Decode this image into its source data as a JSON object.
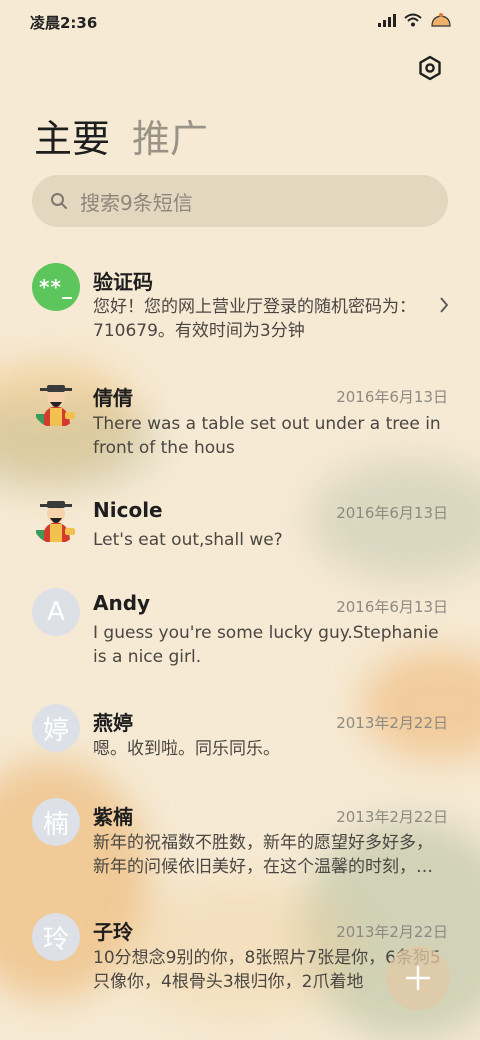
{
  "status": {
    "time": "凌晨2:36"
  },
  "tabs": {
    "primary": "主要",
    "promotions": "推广"
  },
  "search": {
    "placeholder": "搜索9条短信"
  },
  "messages": [
    {
      "avatar_text": "**_",
      "sender": "验证码",
      "date": "",
      "preview": "您好！您的网上营业厅登录的随机密码为：710679。有效时间为3分钟"
    },
    {
      "avatar_text": "",
      "sender": "倩倩",
      "date": "2016年6月13日",
      "preview": "There was a table set out under a tree in front of the hous"
    },
    {
      "avatar_text": "",
      "sender": "Nicole",
      "date": "2016年6月13日",
      "preview": "Let's eat out,shall we?"
    },
    {
      "avatar_text": "A",
      "sender": "Andy",
      "date": "2016年6月13日",
      "preview": "I guess you're some lucky guy.Stephanie is a nice girl."
    },
    {
      "avatar_text": "婷",
      "sender": "燕婷",
      "date": "2013年2月22日",
      "preview": "嗯。收到啦。同乐同乐。"
    },
    {
      "avatar_text": "楠",
      "sender": "紫楠",
      "date": "2013年2月22日",
      "preview": "新年的祝福数不胜数，新年的愿望好多好多，新年的问候依旧美好，在这个温馨的时刻，…"
    },
    {
      "avatar_text": "玲",
      "sender": "子玲",
      "date": "2013年2月22日",
      "preview": "10分想念9别的你，8张照片7张是你，6条狗5只像你，4根骨头3根归你，2爪着地"
    }
  ],
  "colors": {
    "background": "#f6ead4",
    "verification_avatar": "#5cc55c",
    "letter_avatar": "#dde0e6"
  },
  "icons": {
    "settings": "settings-hex-icon",
    "search": "search-icon",
    "compose": "plus-icon",
    "more": "chevron-right-icon"
  }
}
